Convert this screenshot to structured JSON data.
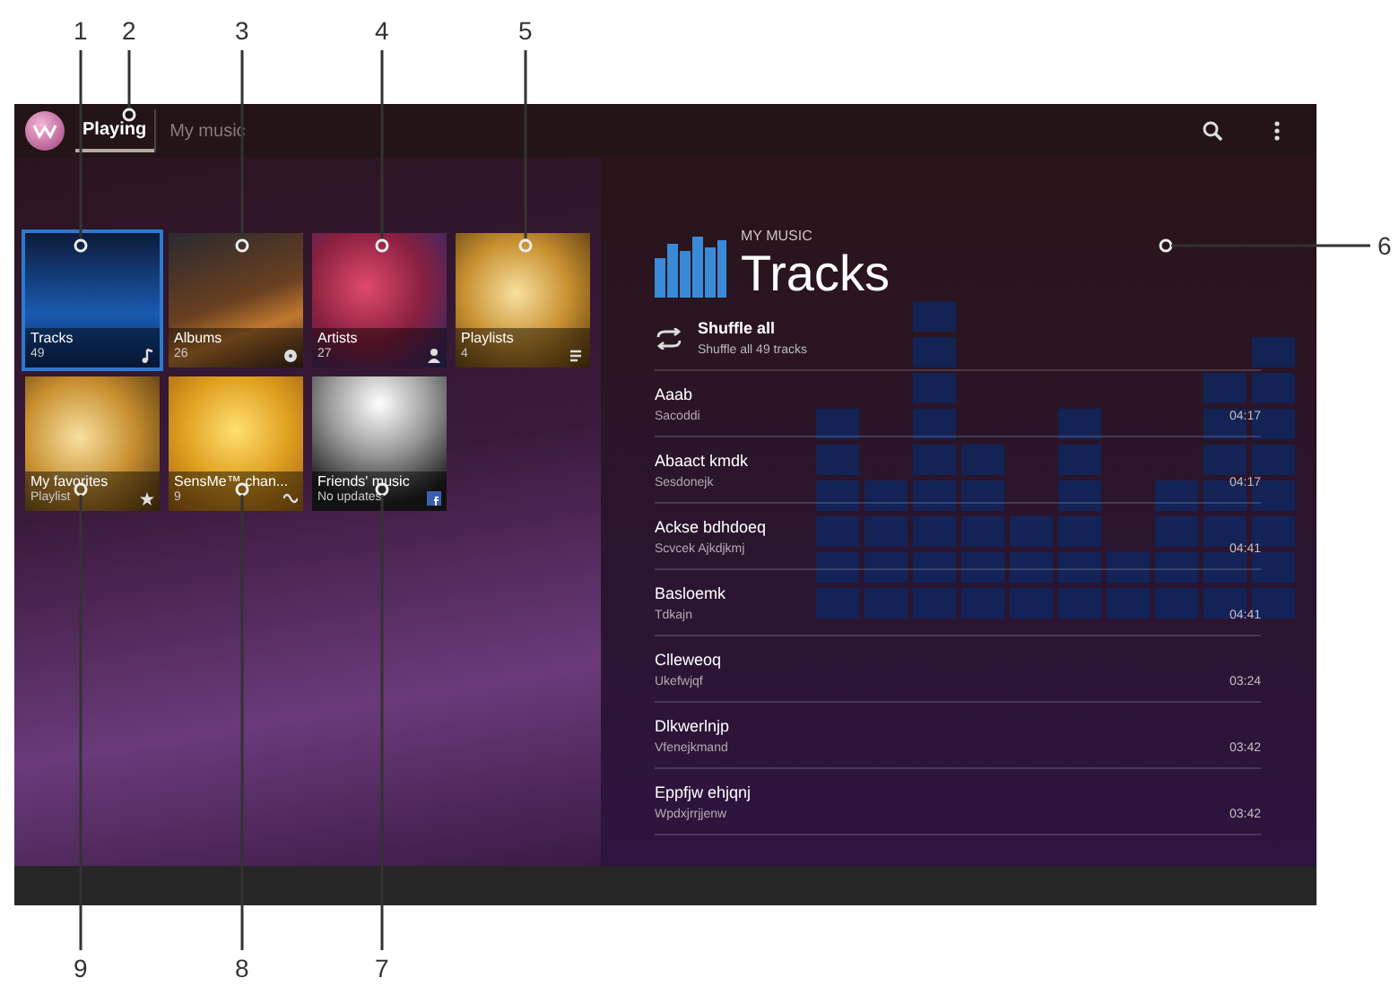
{
  "tabs": [
    {
      "label": "Playing",
      "selected": true
    },
    {
      "label": "My music",
      "selected": false
    }
  ],
  "tiles": [
    {
      "kind": "tracks",
      "title": "Tracks",
      "subtitle": "49",
      "selected": true
    },
    {
      "kind": "albums",
      "title": "Albums",
      "subtitle": "26",
      "selected": false
    },
    {
      "kind": "artists",
      "title": "Artists",
      "subtitle": "27",
      "selected": false
    },
    {
      "kind": "playlists",
      "title": "Playlists",
      "subtitle": "4",
      "selected": false
    },
    {
      "kind": "favorites",
      "title": "My favorites",
      "subtitle": "Playlist",
      "selected": false
    },
    {
      "kind": "sensme",
      "title": "SensMe™ chan...",
      "subtitle": "9",
      "selected": false
    },
    {
      "kind": "friends",
      "title": "Friends' music",
      "subtitle": "No updates",
      "selected": false
    }
  ],
  "header": {
    "overline": "MY MUSIC",
    "title": "Tracks"
  },
  "shuffle": {
    "title": "Shuffle all",
    "subtitle": "Shuffle all 49 tracks"
  },
  "tracks": [
    {
      "title": "Aaab",
      "artist": "Sacoddi",
      "duration": "04:17"
    },
    {
      "title": "Abaact kmdk",
      "artist": "Sesdonejk",
      "duration": "04:17"
    },
    {
      "title": "Ackse bdhdoeq",
      "artist": "Scvcek Ajkdjkmj",
      "duration": "04:41"
    },
    {
      "title": "Basloemk",
      "artist": "Tdkajn",
      "duration": "04:41"
    },
    {
      "title": "Clleweoq",
      "artist": "Ukefwjqf",
      "duration": "03:24"
    },
    {
      "title": "Dlkwerlnjp",
      "artist": "Vfenejkmand",
      "duration": "03:42"
    },
    {
      "title": "Eppfjw ehjqnj",
      "artist": "Wpdxjrrjjenw",
      "duration": "03:42"
    }
  ],
  "callouts": [
    "1",
    "2",
    "3",
    "4",
    "5",
    "6",
    "9",
    "8",
    "7"
  ]
}
